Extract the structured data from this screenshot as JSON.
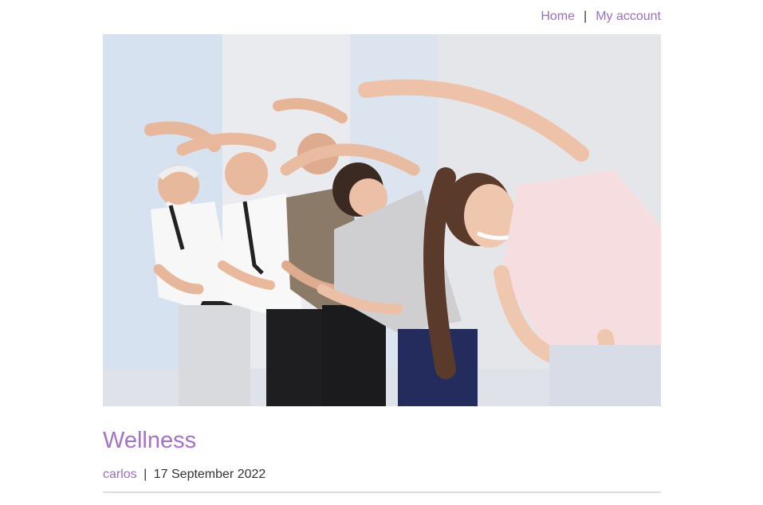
{
  "nav": {
    "home_label": "Home",
    "separator": "|",
    "account_label": "My account"
  },
  "post": {
    "title": "Wellness",
    "author": "carlos",
    "meta_separator": "|",
    "date": "17 September 2022",
    "image_description_icon": "photo-group-exercise-stretching"
  },
  "colors": {
    "link": "#9b6fc2",
    "title": "#a472c5",
    "text": "#333333",
    "divider": "#dddddd"
  }
}
